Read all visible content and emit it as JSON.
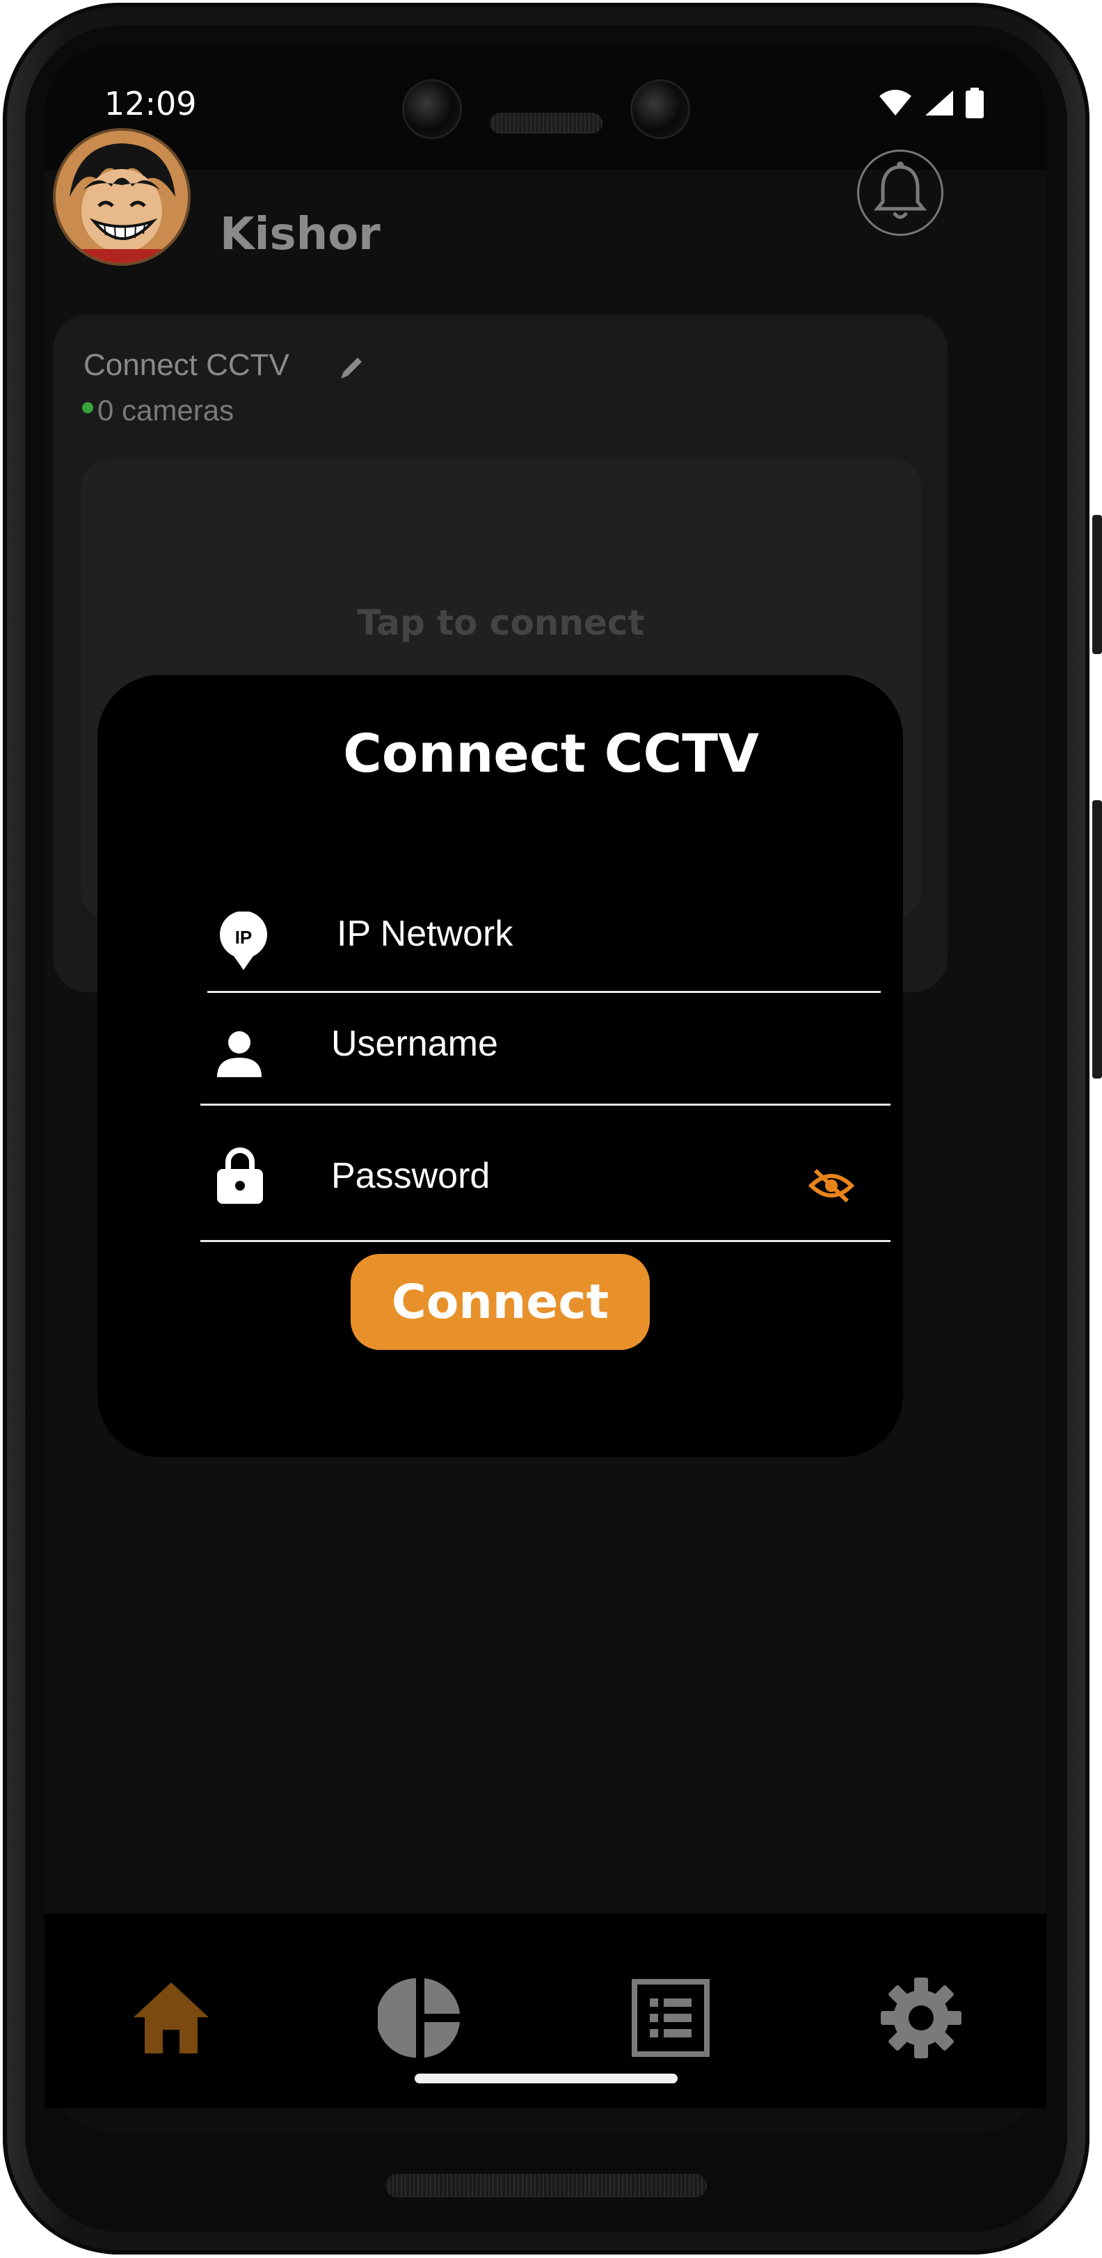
{
  "status_bar": {
    "time": "12:09",
    "icons": [
      "wifi-icon",
      "signal-icon",
      "battery-icon"
    ]
  },
  "header": {
    "username": "Kishor",
    "avatar_icon": "avatar-icon",
    "notification_icon": "bell-icon"
  },
  "camera_card": {
    "title": "Connect CCTV",
    "edit_icon": "pencil-icon",
    "camera_count": "0 cameras",
    "preview_hint": "Tap to connect"
  },
  "connect_modal": {
    "title": "Connect CCTV",
    "fields": {
      "ip": {
        "placeholder": "IP Network",
        "icon": "ip-location-icon"
      },
      "username": {
        "placeholder": "Username",
        "icon": "person-icon"
      },
      "password": {
        "placeholder": "Password",
        "icon": "lock-icon",
        "toggle_icon": "eye-off-icon"
      }
    },
    "connect_label": "Connect"
  },
  "bottom_nav": {
    "items": [
      {
        "id": "home",
        "icon": "home-icon",
        "active": true
      },
      {
        "id": "analytics",
        "icon": "pie-chart-icon",
        "active": false
      },
      {
        "id": "list",
        "icon": "list-icon",
        "active": false
      },
      {
        "id": "settings",
        "icon": "gear-icon",
        "active": false
      }
    ]
  },
  "colors": {
    "accent": "#e8912a",
    "active_nav": "#7a4a10",
    "inactive_nav": "#7a7a7a",
    "online": "#37a33a",
    "eye_toggle": "#e8841a"
  }
}
